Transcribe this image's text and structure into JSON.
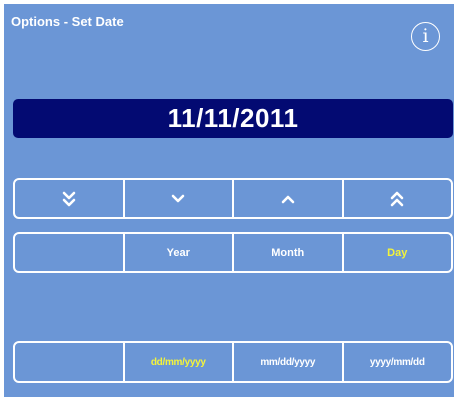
{
  "header": {
    "title": "Options - Set Date",
    "info_symbol": "i",
    "info_icon": "info-icon"
  },
  "date": {
    "value": "11/11/2011"
  },
  "arrows": {
    "fast_down_icon": "double-chevron-down-icon",
    "down_icon": "chevron-down-icon",
    "up_icon": "chevron-up-icon",
    "fast_up_icon": "double-chevron-up-icon"
  },
  "fields": {
    "blank": "",
    "year": "Year",
    "month": "Month",
    "day": "Day",
    "selected": "Day"
  },
  "formats": {
    "blank": "",
    "dmy": "dd/mm/yyyy",
    "mdy": "mm/dd/yyyy",
    "ymd": "yyyy/mm/dd",
    "selected": "dd/mm/yyyy"
  },
  "colors": {
    "background": "#6b96d6",
    "display": "#030a72",
    "selected_text": "#f4f43a",
    "text": "#ffffff"
  }
}
